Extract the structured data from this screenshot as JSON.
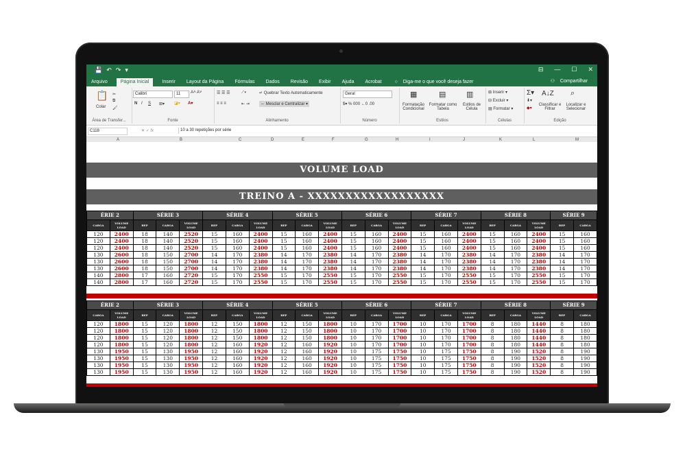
{
  "excel": {
    "qat": [
      "💾",
      "↶",
      "↷",
      "▾"
    ],
    "window_controls": [
      "⊟",
      "—",
      "☐",
      "✕"
    ],
    "tabs": [
      "Arquivo",
      "Página Inicial",
      "Inserir",
      "Layout da Página",
      "Fórmulas",
      "Dados",
      "Revisão",
      "Exibir",
      "Ajuda",
      "Acrobat"
    ],
    "tell_me": "Diga-me o que você deseja fazer",
    "share": "Compartilhar",
    "ribbon": {
      "paste": "Colar",
      "clipboard": "Área de Transfer...",
      "font_name": "Calibri",
      "font_size": "11",
      "font_group": "Fonte",
      "bold": "N",
      "italic": "I",
      "underline": "S",
      "wrap_text": "Quebrar Texto Automaticamente",
      "merge_center": "Mesclar e Centralizar",
      "alignment_group": "Alinhamento",
      "number_format": "Geral",
      "number_group": "Número",
      "cond_format": "Formatação Condicional",
      "format_table": "Formatar como Tabela",
      "cell_styles": "Estilos de Célula",
      "styles_group": "Estilos",
      "insert": "Inserir",
      "delete": "Excluir",
      "format": "Formatar",
      "cells_group": "Células",
      "sort_filter": "Classificar e Filtrar",
      "find_select": "Localizar e Selecionar",
      "edit_group": "Edição"
    },
    "name_box": "C118",
    "formula": "10 a 30 repetições por série",
    "columns": [
      "A",
      "B",
      "C",
      "D",
      "E",
      "F",
      "G",
      "H",
      "I",
      "J",
      "K",
      "L",
      "M"
    ]
  },
  "sheet": {
    "title": "VOLUME LOAD",
    "subtitle": "TREINO A - XXXXXXXXXXXXXXXXXX",
    "series_headers": [
      "ÉRIE 2",
      "SÉRIE 3",
      "SÉRIE 4",
      "SÉRIE 5",
      "SÉRIE 6",
      "SÉRIE 7",
      "SÉRIE 8",
      "SÉRIE 9"
    ],
    "col_labels": [
      "CARGA",
      "VOLUME LOAD",
      "REP",
      "CARGA",
      "VOLUME LOAD",
      "REP",
      "CARGA",
      "VOLUME LOAD",
      "REP",
      "CARGA",
      "VOLUME LOAD",
      "REP",
      "CARGA",
      "VOLUME LOAD",
      "REP",
      "CARGA",
      "VOLUME LOAD",
      "REP",
      "CARGA",
      "VOLUME LOAD",
      "REP",
      "CARGA"
    ],
    "table1": [
      [
        "120",
        "2400",
        "18",
        "140",
        "2520",
        "15",
        "160",
        "2400",
        "15",
        "160",
        "2400",
        "15",
        "160",
        "2400",
        "15",
        "160",
        "2400",
        "15",
        "160",
        "2400",
        "15",
        "160"
      ],
      [
        "120",
        "2400",
        "18",
        "140",
        "2520",
        "15",
        "160",
        "2400",
        "15",
        "160",
        "2400",
        "15",
        "160",
        "2400",
        "15",
        "160",
        "2400",
        "15",
        "160",
        "2400",
        "15",
        "160"
      ],
      [
        "120",
        "2400",
        "18",
        "140",
        "2520",
        "15",
        "160",
        "2400",
        "15",
        "160",
        "2400",
        "15",
        "160",
        "2400",
        "15",
        "160",
        "2400",
        "15",
        "160",
        "2400",
        "15",
        "160"
      ],
      [
        "130",
        "2600",
        "18",
        "150",
        "2700",
        "14",
        "170",
        "2380",
        "14",
        "170",
        "2380",
        "14",
        "170",
        "2380",
        "14",
        "170",
        "2380",
        "14",
        "170",
        "2380",
        "14",
        "170"
      ],
      [
        "130",
        "2600",
        "18",
        "150",
        "2700",
        "14",
        "170",
        "2380",
        "14",
        "170",
        "2380",
        "14",
        "170",
        "2380",
        "14",
        "170",
        "2380",
        "14",
        "170",
        "2380",
        "14",
        "170"
      ],
      [
        "130",
        "2600",
        "18",
        "150",
        "2700",
        "14",
        "170",
        "2380",
        "14",
        "170",
        "2380",
        "14",
        "170",
        "2380",
        "14",
        "170",
        "2380",
        "14",
        "170",
        "2380",
        "14",
        "170"
      ],
      [
        "140",
        "2800",
        "17",
        "160",
        "2720",
        "15",
        "170",
        "2550",
        "15",
        "170",
        "2550",
        "15",
        "170",
        "2550",
        "15",
        "170",
        "2550",
        "15",
        "170",
        "2550",
        "15",
        "170"
      ],
      [
        "140",
        "2800",
        "17",
        "160",
        "2720",
        "15",
        "170",
        "2550",
        "15",
        "170",
        "2550",
        "15",
        "170",
        "2550",
        "15",
        "170",
        "2550",
        "15",
        "170",
        "2550",
        "15",
        "170"
      ]
    ],
    "table2": [
      [
        "120",
        "1800",
        "15",
        "120",
        "1800",
        "12",
        "150",
        "1800",
        "12",
        "150",
        "1800",
        "10",
        "170",
        "1700",
        "10",
        "170",
        "1700",
        "8",
        "180",
        "1440",
        "8",
        "180"
      ],
      [
        "120",
        "1800",
        "15",
        "120",
        "1800",
        "12",
        "150",
        "1800",
        "12",
        "150",
        "1800",
        "10",
        "170",
        "1700",
        "10",
        "170",
        "1700",
        "8",
        "180",
        "1440",
        "8",
        "180"
      ],
      [
        "120",
        "1800",
        "15",
        "120",
        "1800",
        "12",
        "150",
        "1800",
        "12",
        "150",
        "1800",
        "10",
        "170",
        "1700",
        "10",
        "170",
        "1700",
        "8",
        "180",
        "1440",
        "8",
        "180"
      ],
      [
        "120",
        "1800",
        "15",
        "120",
        "1800",
        "12",
        "160",
        "1920",
        "12",
        "160",
        "1920",
        "10",
        "170",
        "1700",
        "10",
        "170",
        "1700",
        "8",
        "180",
        "1440",
        "8",
        "180"
      ],
      [
        "130",
        "1950",
        "15",
        "130",
        "1950",
        "12",
        "160",
        "1920",
        "12",
        "160",
        "1920",
        "10",
        "175",
        "1750",
        "10",
        "175",
        "1750",
        "8",
        "190",
        "1520",
        "8",
        "190"
      ],
      [
        "130",
        "1950",
        "15",
        "130",
        "1950",
        "12",
        "160",
        "1920",
        "12",
        "160",
        "1920",
        "10",
        "175",
        "1750",
        "10",
        "175",
        "1750",
        "8",
        "190",
        "1520",
        "8",
        "190"
      ],
      [
        "130",
        "1950",
        "15",
        "130",
        "1950",
        "12",
        "160",
        "1920",
        "12",
        "160",
        "1920",
        "10",
        "175",
        "1750",
        "10",
        "175",
        "1750",
        "8",
        "190",
        "1520",
        "8",
        "190"
      ],
      [
        "130",
        "1950",
        "15",
        "130",
        "1950",
        "12",
        "160",
        "1920",
        "12",
        "160",
        "1920",
        "10",
        "175",
        "1750",
        "10",
        "175",
        "1750",
        "8",
        "190",
        "1520",
        "8",
        "190"
      ]
    ]
  }
}
